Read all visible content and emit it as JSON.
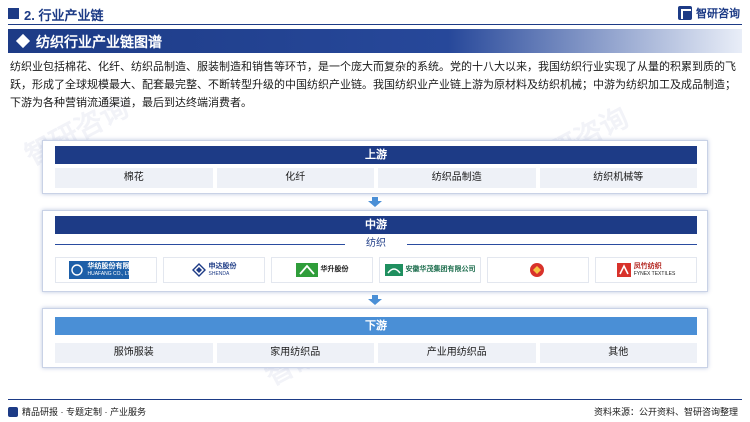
{
  "header": {
    "section_title": "2. 行业产业链",
    "brand": "智研咨询"
  },
  "title_bar": {
    "title": "纺织行业产业链图谱"
  },
  "intro": "纺织业包括棉花、化纤、纺织品制造、服装制造和销售等环节，是一个庞大而复杂的系统。党的十八大以来，我国纺织行业实现了从量的积累到质的飞跃，形成了全球规模最大、配套最完整、不断转型升级的中国纺织产业链。我国纺织业产业链上游为原材料及纺织机械；中游为纺织加工及成品制造；下游为各种营销流通渠道，最后到达终端消费者。",
  "upstream": {
    "label": "上游",
    "items": [
      "棉花",
      "化纤",
      "纺织品制造",
      "纺织机械等"
    ]
  },
  "midstream": {
    "label": "中游",
    "sub_label": "纺织",
    "companies": [
      {
        "name": "华纺股份有限公司",
        "sub": "HUAFANG CO., LTD"
      },
      {
        "name": "申达股份",
        "sub": "SHENDA"
      },
      {
        "name": "华升股份",
        "sub": ""
      },
      {
        "name": "安徽华茂集团有限公司",
        "sub": ""
      },
      {
        "name": "",
        "sub": ""
      },
      {
        "name": "凤竹纺织",
        "sub": "FYNEX TEXTILES"
      }
    ]
  },
  "downstream": {
    "label": "下游",
    "items": [
      "服饰服装",
      "家用纺织品",
      "产业用纺织品",
      "其他"
    ]
  },
  "footer": {
    "left": "精品研报 · 专题定制 · 产业服务",
    "source": "资料来源：公开资料、智研咨询整理"
  },
  "colors": {
    "primary": "#1d3b86",
    "downstream_bar": "#4a8fd6",
    "cell_bg": "#eef1f7"
  }
}
